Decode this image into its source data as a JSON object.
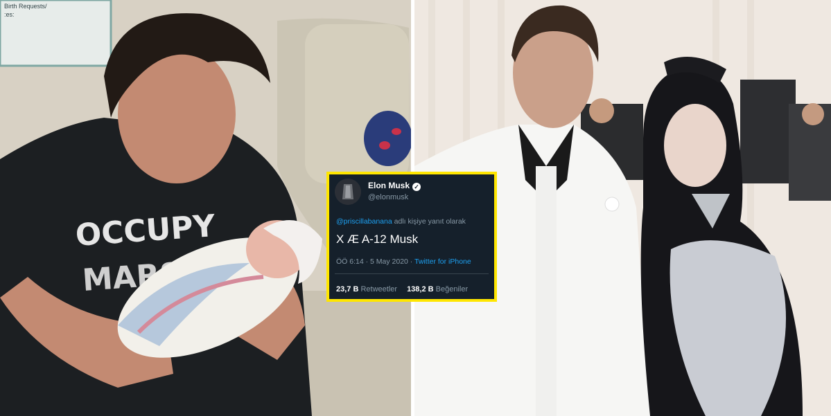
{
  "left_photo": {
    "shirt_line1": "OCCUPY",
    "shirt_line2": "MARS",
    "wall_sign_text": "Birth Requests / :es:"
  },
  "tweet": {
    "author_name": "Elon Musk",
    "author_handle": "@elonmusk",
    "verified_icon": "verified-badge-icon",
    "reply_mention": "@priscillabanana",
    "reply_suffix": " adlı kişiye yanıt olarak",
    "text": "X Æ A-12 Musk",
    "time": "ÖÖ 6:14 · 5 May 2020 · ",
    "source": "Twitter for iPhone",
    "retweets_count": "23,7 B",
    "retweets_label": " Retweetler",
    "likes_count": "138,2 B",
    "likes_label": " Beğeniler"
  },
  "colors": {
    "card_background": "#15202b",
    "card_border": "#ffe600",
    "link_blue": "#1da1f2",
    "muted_text": "#8899a6"
  }
}
